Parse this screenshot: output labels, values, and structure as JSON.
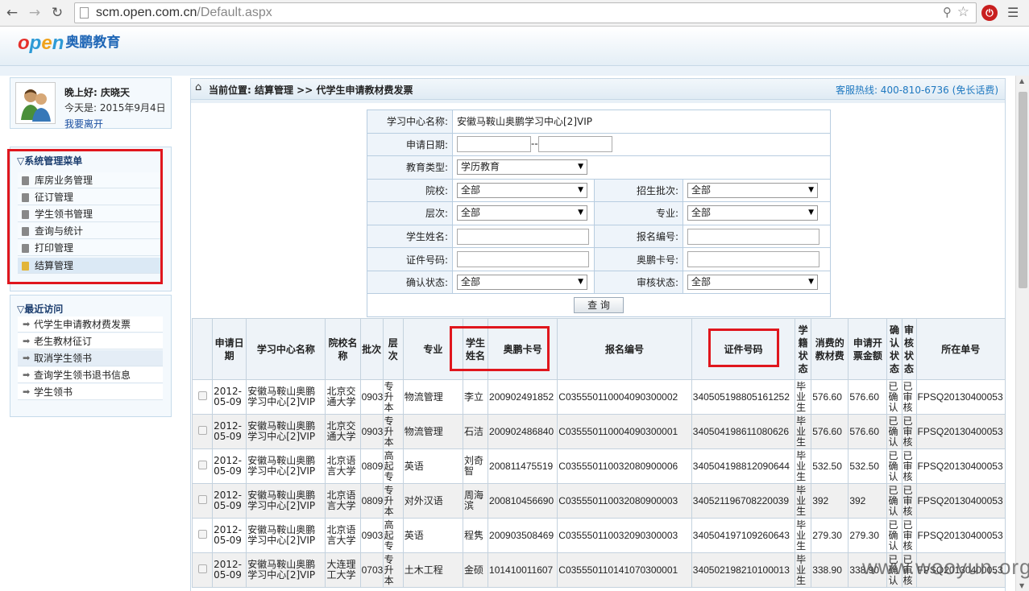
{
  "browser": {
    "url_host": "scm.open.com.cn",
    "url_path": "/Default.aspx"
  },
  "header": {
    "logo_text": "奥鹏教育"
  },
  "user": {
    "greeting": "晚上好: 庆晓天",
    "today": "今天是: 2015年9月4日",
    "leave": "我要离开"
  },
  "sys_menu": {
    "title": "系统管理菜单",
    "items": [
      "库房业务管理",
      "征订管理",
      "学生领书管理",
      "查询与统计",
      "打印管理",
      "结算管理"
    ]
  },
  "recent": {
    "title": "最近访问",
    "items": [
      "代学生申请教材费发票",
      "老生教材征订",
      "取消学生领书",
      "查询学生领书退书信息",
      "学生领书"
    ]
  },
  "breadcrumb": {
    "path": "当前位置: 结算管理 >> 代学生申请教材费发票",
    "hotline": "客服热线: 400-810-6736 (免长话费)"
  },
  "filter": {
    "center_label": "学习中心名称:",
    "center_value": "安徽马鞍山奥鹏学习中心[2]VIP",
    "date_label": "申请日期:",
    "date_sep": "--",
    "edu_label": "教育类型:",
    "edu_value": "学历教育",
    "school_label": "院校:",
    "school_value": "全部",
    "batch_label": "招生批次:",
    "batch_value": "全部",
    "level_label": "层次:",
    "level_value": "全部",
    "major_label": "专业:",
    "major_value": "全部",
    "name_label": "学生姓名:",
    "regno_label": "报名编号:",
    "idno_label": "证件号码:",
    "card_label": "奥鹏卡号:",
    "confirm_label": "确认状态:",
    "confirm_value": "全部",
    "audit_label": "审核状态:",
    "audit_value": "全部",
    "query_button": "查 询"
  },
  "table": {
    "headers": [
      "申请日期",
      "学习中心名称",
      "院校名称",
      "批次",
      "层次",
      "专业",
      "学生姓名",
      "奥鹏卡号",
      "报名编号",
      "证件号码",
      "学籍状态",
      "消费的教材费",
      "申请开票金额",
      "确认状态",
      "审核状态",
      "所在单号"
    ],
    "rows": [
      [
        "2012-05-09",
        "安徽马鞍山奥鹏学习中心[2]VIP",
        "北京交通大学",
        "0903",
        "专升本",
        "物流管理",
        "李立",
        "200902491852",
        "C035550110004090300002",
        "340505198805161252",
        "毕业生",
        "576.60",
        "576.60",
        "已确认",
        "已审核",
        "FPSQ20130400053"
      ],
      [
        "2012-05-09",
        "安徽马鞍山奥鹏学习中心[2]VIP",
        "北京交通大学",
        "0903",
        "专升本",
        "物流管理",
        "石洁",
        "200902486840",
        "C035550110004090300001",
        "340504198611080626",
        "毕业生",
        "576.60",
        "576.60",
        "已确认",
        "已审核",
        "FPSQ20130400053"
      ],
      [
        "2012-05-09",
        "安徽马鞍山奥鹏学习中心[2]VIP",
        "北京语言大学",
        "0809",
        "高起专",
        "英语",
        "刘奇智",
        "200811475519",
        "C035550110032080900006",
        "340504198812090644",
        "毕业生",
        "532.50",
        "532.50",
        "已确认",
        "已审核",
        "FPSQ20130400053"
      ],
      [
        "2012-05-09",
        "安徽马鞍山奥鹏学习中心[2]VIP",
        "北京语言大学",
        "0809",
        "专升本",
        "对外汉语",
        "周海滨",
        "200810456690",
        "C035550110032080900003",
        "340521196708220039",
        "毕业生",
        "392",
        "392",
        "已确认",
        "已审核",
        "FPSQ20130400053"
      ],
      [
        "2012-05-09",
        "安徽马鞍山奥鹏学习中心[2]VIP",
        "北京语言大学",
        "0903",
        "高起专",
        "英语",
        "程隽",
        "200903508469",
        "C035550110032090300003",
        "340504197109260643",
        "毕业生",
        "279.30",
        "279.30",
        "已确认",
        "已审核",
        "FPSQ20130400053"
      ],
      [
        "2012-05-09",
        "安徽马鞍山奥鹏学习中心[2]VIP",
        "大连理工大学",
        "0703",
        "专升本",
        "土木工程",
        "金硕",
        "101410011607",
        "C035550110141070300001",
        "340502198210100013",
        "毕业生",
        "338.90",
        "338.90",
        "已确认",
        "已审核",
        "FPSQ20130400053"
      ]
    ]
  },
  "watermark": "www.wooyun.org",
  "colors": {
    "highlight_border": "#e0161d",
    "link": "#1a4fa0",
    "hotline": "#1e78c0"
  }
}
